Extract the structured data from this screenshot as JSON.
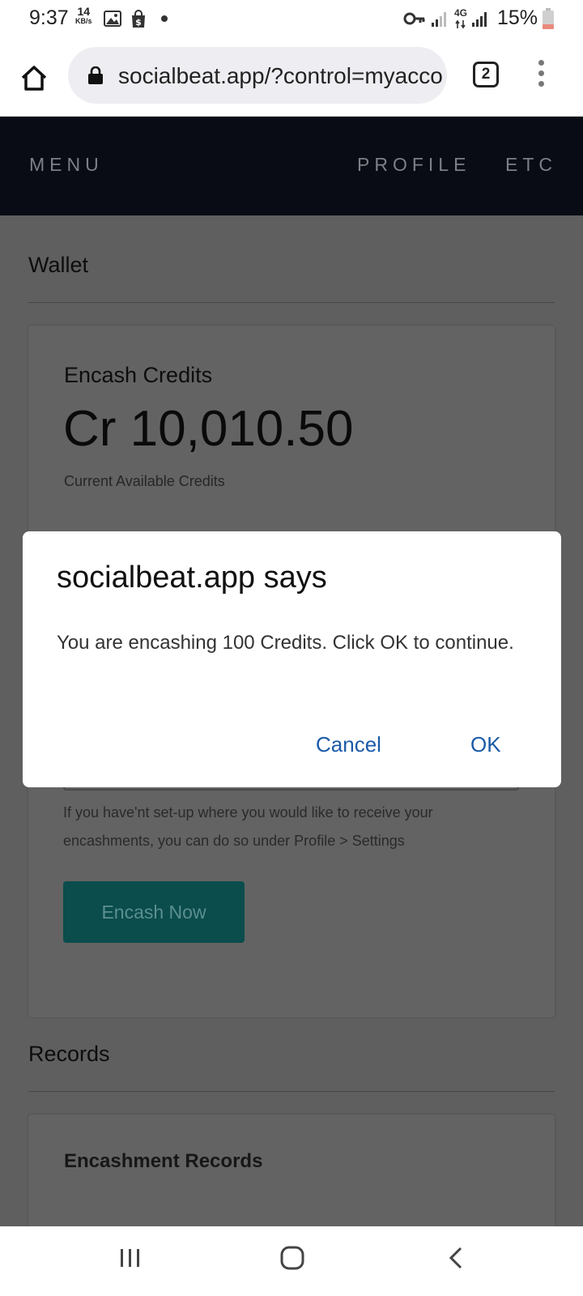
{
  "status_bar": {
    "time": "9:37",
    "net_speed_value": "14",
    "net_speed_unit": "KB/s",
    "network_label": "4G",
    "battery_percent": "15%"
  },
  "browser": {
    "url": "socialbeat.app/?control=myaccount",
    "tab_count": "2"
  },
  "navbar": {
    "menu_label": "MENU",
    "profile_label": "PROFILE",
    "etc_label": "ETC"
  },
  "wallet": {
    "section_title": "Wallet",
    "card_title": "Encash Credits",
    "balance": "Cr 10,010.50",
    "balance_caption": "Current Available Credits",
    "help_text": "If you have'nt set-up where you would like to receive your encashments, you can do so under Profile > Settings",
    "encash_button_label": "Encash Now"
  },
  "records": {
    "section_title": "Records",
    "card_title": "Encashment Records"
  },
  "dialog": {
    "title": "socialbeat.app says",
    "message": "You are encashing 100 Credits. Click OK to continue.",
    "cancel_label": "Cancel",
    "ok_label": "OK"
  },
  "colors": {
    "accent_blue": "#1a5aa8",
    "navbar_bg": "#090c14",
    "encash_button_bg": "#0b4c4c"
  }
}
